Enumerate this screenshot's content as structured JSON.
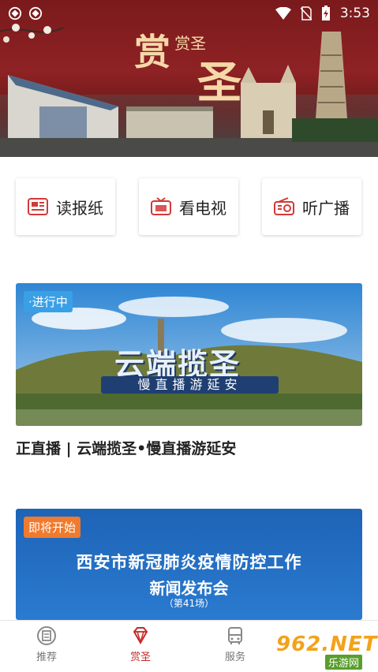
{
  "status_bar": {
    "time": "3:53",
    "icons": [
      "app-notification-icon",
      "app-notification-icon",
      "wifi-icon",
      "no-sim-icon",
      "battery-charging-icon"
    ]
  },
  "banner": {
    "title_char_1": "赏",
    "title_small": "赏圣",
    "title_char_2": "圣"
  },
  "quick_links": [
    {
      "label": "读报纸",
      "icon": "newspaper-icon"
    },
    {
      "label": "看电视",
      "icon": "tv-icon"
    },
    {
      "label": "听广播",
      "icon": "radio-icon"
    }
  ],
  "live_card": {
    "badge": "·进行中",
    "overlay_title": "云端揽圣",
    "overlay_subtitle": "慢直播游延安",
    "title": "正直播 | 云端揽圣•慢直播游延安"
  },
  "upcoming_card": {
    "badge": "即将开始",
    "headline_line1": "西安市新冠肺炎疫情防控工作",
    "headline_line2": "新闻发布会",
    "headline_line3": "（第41场）"
  },
  "tab_bar": {
    "tabs": [
      {
        "label": "推荐",
        "icon": "recommend-icon"
      },
      {
        "label": "赏圣",
        "icon": "diamond-icon"
      },
      {
        "label": "服务",
        "icon": "bus-icon"
      }
    ],
    "active_index": 1
  },
  "watermark": {
    "brand": "962.NET",
    "sub": "乐游网"
  },
  "colors": {
    "accent": "#c62a28",
    "live_badge": "#3aa0e6",
    "upcoming_badge": "#f07a2d",
    "banner_red": "#8e2224"
  }
}
